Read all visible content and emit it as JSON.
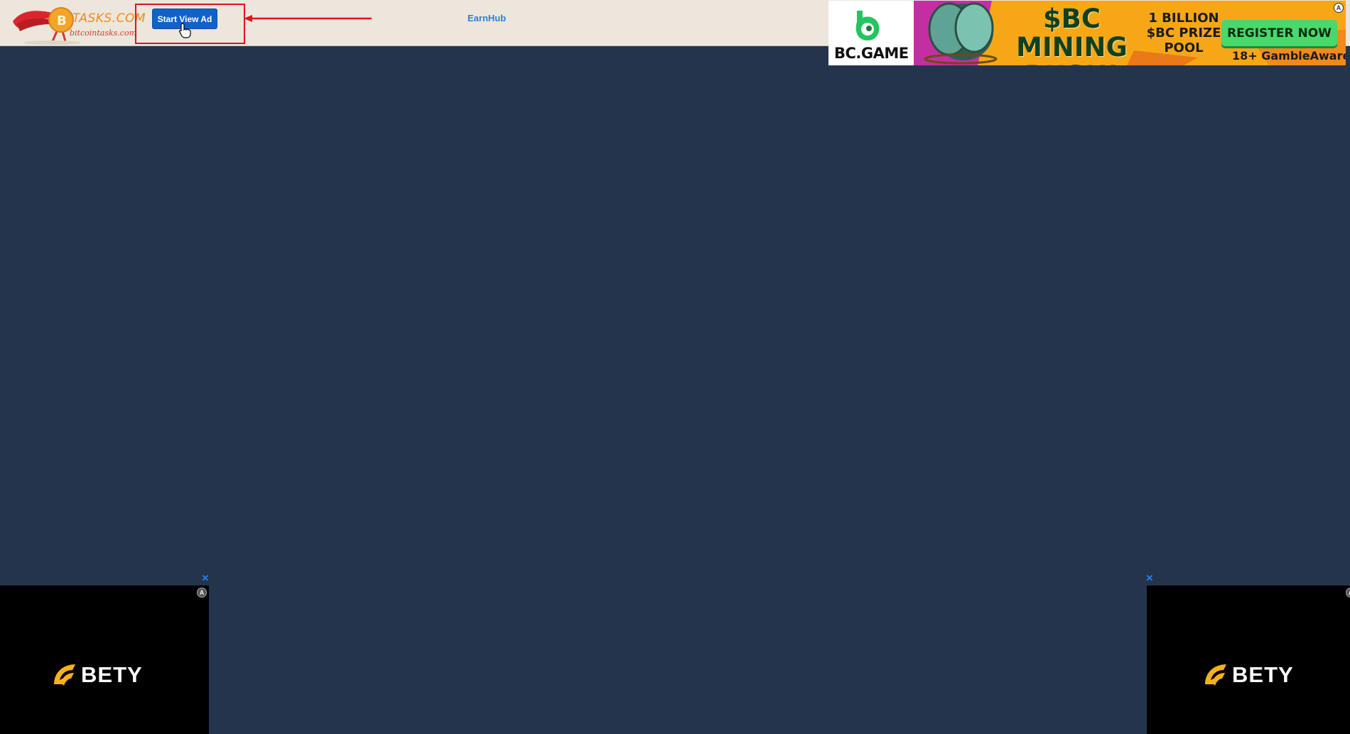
{
  "header": {
    "logo_title": "TASKS.COM",
    "logo_subtitle": "bitcointasks.com",
    "start_button_label": "Start View Ad",
    "nav_link": "EarnHub"
  },
  "top_ad": {
    "brand": "BC.GAME",
    "headline": "$BC MINING RUSH!",
    "prize": "1 BILLION $BC PRIZE POOL",
    "cta": "REGISTER NOW",
    "gamble": "18+ GambleAware"
  },
  "side_ads": {
    "left_brand": "BETY",
    "right_brand": "BETY"
  },
  "colors": {
    "background": "#25344d",
    "topbar": "#ece6dc",
    "button": "#1062c8",
    "highlight": "#e0141b",
    "link": "#2d7ed8"
  }
}
